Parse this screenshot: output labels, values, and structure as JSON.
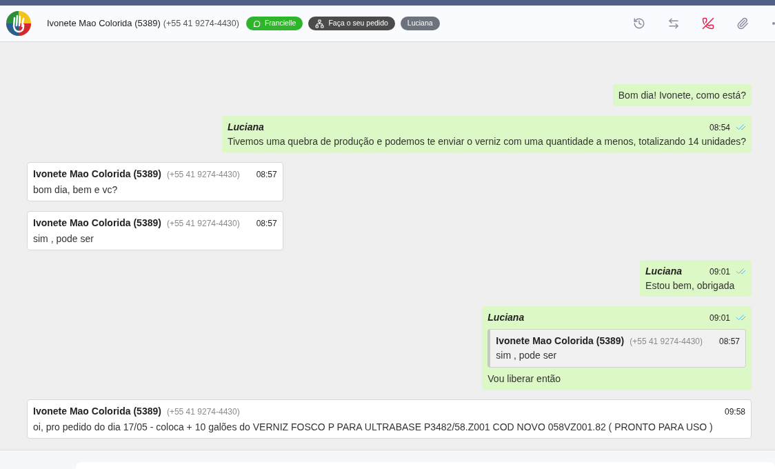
{
  "header": {
    "contact_name": "Ivonete Mao Colorida (5389)",
    "contact_phone": "(+55 41 9274-4430)",
    "tags": [
      {
        "kind": "whatsapp",
        "label": "Francielle",
        "color": "#2eb52a"
      },
      {
        "kind": "queue",
        "label": "Faça o seu pedido",
        "color": "#4b4b4b"
      },
      {
        "kind": "user",
        "label": "Luciana",
        "color": "#6c737d"
      }
    ]
  },
  "messages": [
    {
      "kind": "out",
      "text": "Bom dia! Ivonete, como está?"
    },
    {
      "kind": "out",
      "sender": "Luciana",
      "time": "08:54",
      "text": "Tivemos uma quebra de produção e podemos te enviar o verniz com uma quantidade a menos, totalizando 14 unidades?",
      "read": true
    },
    {
      "kind": "in",
      "sender": "Ivonete Mao Colorida (5389)",
      "phone": "(+55 41 9274-4430)",
      "time": "08:57",
      "text": "bom dia, bem e vc?"
    },
    {
      "kind": "in",
      "sender": "Ivonete Mao Colorida (5389)",
      "phone": "(+55 41 9274-4430)",
      "time": "08:57",
      "text": "sim , pode ser"
    },
    {
      "kind": "out",
      "sender": "Luciana",
      "time": "09:01",
      "text": "Estou bem, obrigada",
      "read": true
    },
    {
      "kind": "out",
      "sender": "Luciana",
      "time": "09:01",
      "text": "Vou liberar então",
      "read": true,
      "quote": {
        "sender": "Ivonete Mao Colorida (5389)",
        "phone": "(+55 41 9274-4430)",
        "time": "08:57",
        "text": "sim , pode ser"
      }
    },
    {
      "kind": "in",
      "wide": true,
      "sender": "Ivonete Mao Colorida (5389)",
      "phone": "(+55 41 9274-4430)",
      "time": "09:58",
      "text": "oi, pro pedido do dia 17/05 - coloca + 10 galões do VERNIZ FOSCO P PARA ULTRABASE P3482/58.Z001 COD NOVO 058VZ001.82 ( PRONTO PARA USO )"
    }
  ]
}
